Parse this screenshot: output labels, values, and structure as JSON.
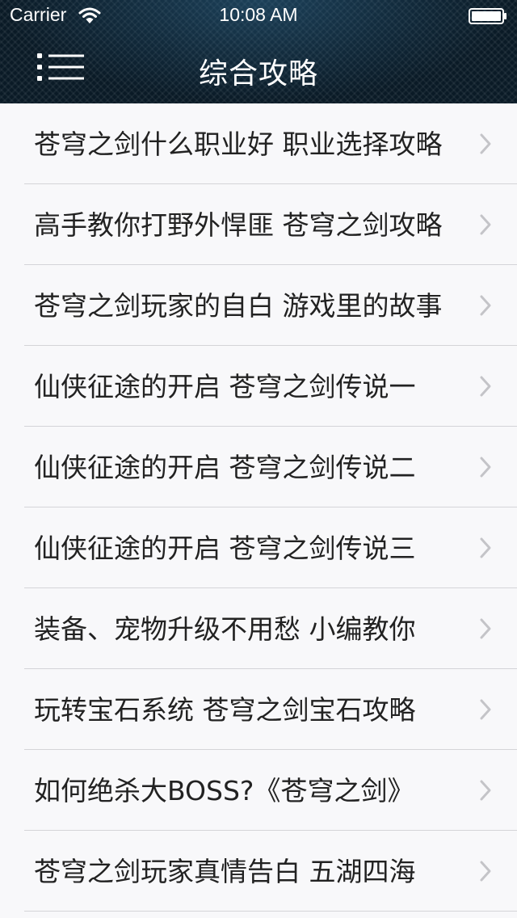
{
  "status_bar": {
    "carrier": "Carrier",
    "time": "10:08 AM",
    "wifi_icon": "wifi-icon",
    "battery_icon": "battery-icon"
  },
  "nav": {
    "title": "综合攻略",
    "menu_icon": "list-menu-icon",
    "background_color": "#0a1a26"
  },
  "list": {
    "items": [
      {
        "title": "苍穹之剑什么职业好 职业选择攻略"
      },
      {
        "title": "高手教你打野外悍匪 苍穹之剑攻略"
      },
      {
        "title": "苍穹之剑玩家的自白 游戏里的故事"
      },
      {
        "title": "仙侠征途的开启 苍穹之剑传说一"
      },
      {
        "title": "仙侠征途的开启 苍穹之剑传说二"
      },
      {
        "title": "仙侠征途的开启 苍穹之剑传说三"
      },
      {
        "title": "装备、宠物升级不用愁 小编教你"
      },
      {
        "title": "玩转宝石系统 苍穹之剑宝石攻略"
      },
      {
        "title": "如何绝杀大BOSS?《苍穹之剑》"
      },
      {
        "title": "苍穹之剑玩家真情告白 五湖四海"
      }
    ],
    "chevron_icon": "chevron-right-icon",
    "text_color": "#222222",
    "separator_color": "#d4d4d8",
    "background_color": "#f8f8fa"
  }
}
